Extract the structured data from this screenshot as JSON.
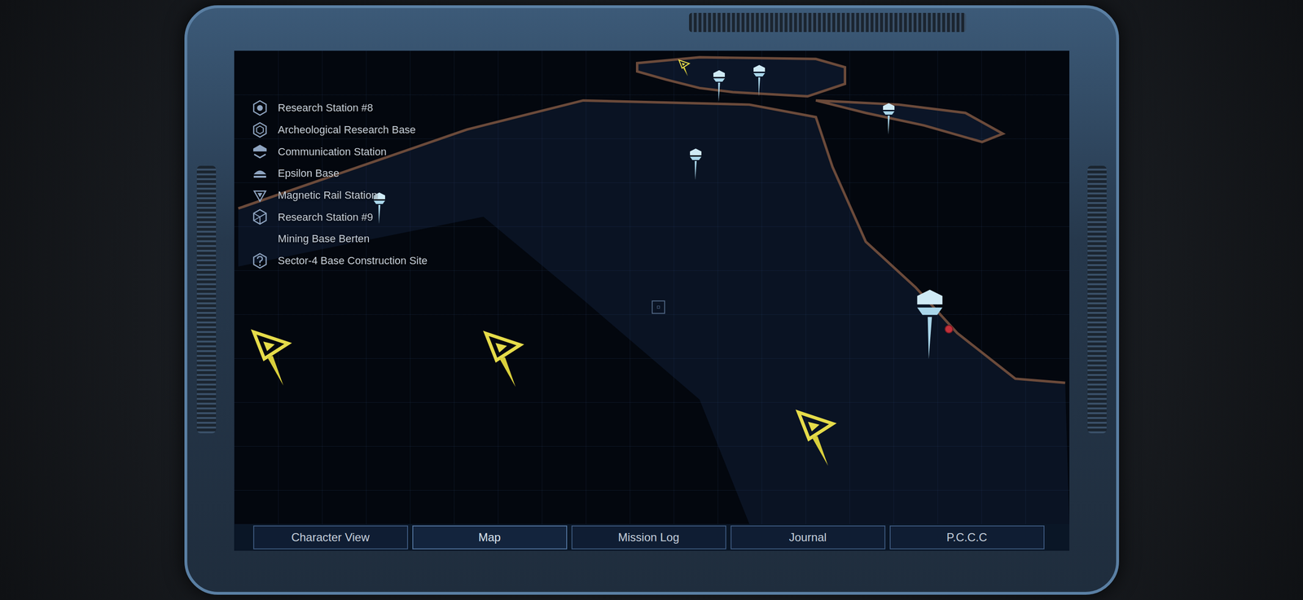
{
  "legend": [
    {
      "label": "Research Station #8",
      "kind": "hex-dot"
    },
    {
      "label": "Archeological Research Base",
      "kind": "hex"
    },
    {
      "label": "Communication Station",
      "kind": "base"
    },
    {
      "label": "Epsilon Base",
      "kind": "dome"
    },
    {
      "label": "Magnetic Rail Station",
      "kind": "triangle"
    },
    {
      "label": "Research Station #9",
      "kind": "cube"
    },
    {
      "label": "Mining Base Berten",
      "kind": "none"
    },
    {
      "label": "Sector-4 Base Construction Site",
      "kind": "question"
    }
  ],
  "markers": [
    {
      "kind": "objective"
    },
    {
      "kind": "objective"
    },
    {
      "kind": "objective"
    },
    {
      "kind": "objective-small"
    },
    {
      "kind": "location"
    },
    {
      "kind": "location"
    },
    {
      "kind": "location"
    },
    {
      "kind": "location"
    },
    {
      "kind": "location-large"
    },
    {
      "kind": "location"
    },
    {
      "kind": "player"
    },
    {
      "kind": "cursor"
    }
  ],
  "tabs": [
    {
      "label": "Character View",
      "selected": false
    },
    {
      "label": "Map",
      "selected": true
    },
    {
      "label": "Mission Log",
      "selected": false
    },
    {
      "label": "Journal",
      "selected": false
    },
    {
      "label": "P.C.C.C",
      "selected": false
    }
  ]
}
